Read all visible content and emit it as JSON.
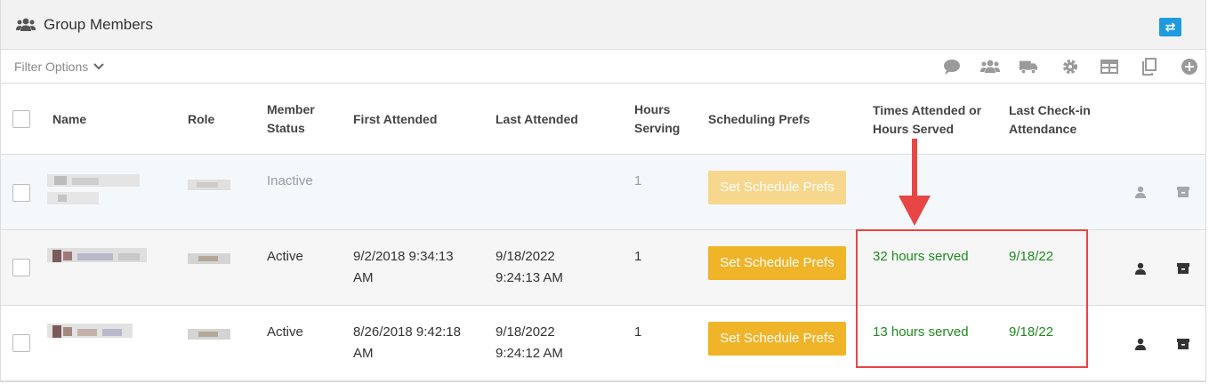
{
  "header": {
    "title": "Group Members",
    "group_icon": "group-icon",
    "swap_icon": "swap-arrows-icon",
    "swap_glyph": "⇄",
    "accent": "#1e9be0"
  },
  "filter": {
    "label": "Filter Options",
    "toolbar_icons": [
      "comment-icon",
      "group-icon",
      "truck-icon",
      "gear-icon",
      "table-icon",
      "copy-icon",
      "plus-circle-icon"
    ]
  },
  "table": {
    "columns": {
      "name": "Name",
      "role": "Role",
      "member_status_1": "Member",
      "member_status_2": "Status",
      "first_attended": "First Attended",
      "last_attended": "Last Attended",
      "hours_serving_1": "Hours",
      "hours_serving_2": "Serving",
      "scheduling_prefs": "Scheduling Prefs",
      "times_attended_1": "Times Attended or",
      "times_attended_2": "Hours Served",
      "last_checkin_1": "Last Check-in",
      "last_checkin_2": "Attendance"
    },
    "rows": [
      {
        "status": "Inactive",
        "first_attended_1": "",
        "first_attended_2": "",
        "last_attended_1": "",
        "last_attended_2": "",
        "hours_serving": "1",
        "pref_button": "Set Schedule Prefs",
        "times_attended": "",
        "last_checkin": ""
      },
      {
        "status": "Active",
        "first_attended_1": "9/2/2018 9:34:13",
        "first_attended_2": "AM",
        "last_attended_1": "9/18/2022",
        "last_attended_2": "9:24:13 AM",
        "hours_serving": "1",
        "pref_button": "Set Schedule Prefs",
        "times_attended": "32 hours served",
        "last_checkin": "9/18/22"
      },
      {
        "status": "Active",
        "first_attended_1": "8/26/2018 9:42:18",
        "first_attended_2": "AM",
        "last_attended_1": "9/18/2022",
        "last_attended_2": "9:24:12 AM",
        "hours_serving": "1",
        "pref_button": "Set Schedule Prefs",
        "times_attended": "13 hours served",
        "last_checkin": "9/18/22"
      }
    ],
    "row_action_icons": [
      "person-icon",
      "archive-icon"
    ]
  },
  "colors": {
    "button": "#f0b429",
    "button_disabled": "#f7d78d",
    "served_text": "#1f8a1f",
    "annotation": "#e84545"
  }
}
